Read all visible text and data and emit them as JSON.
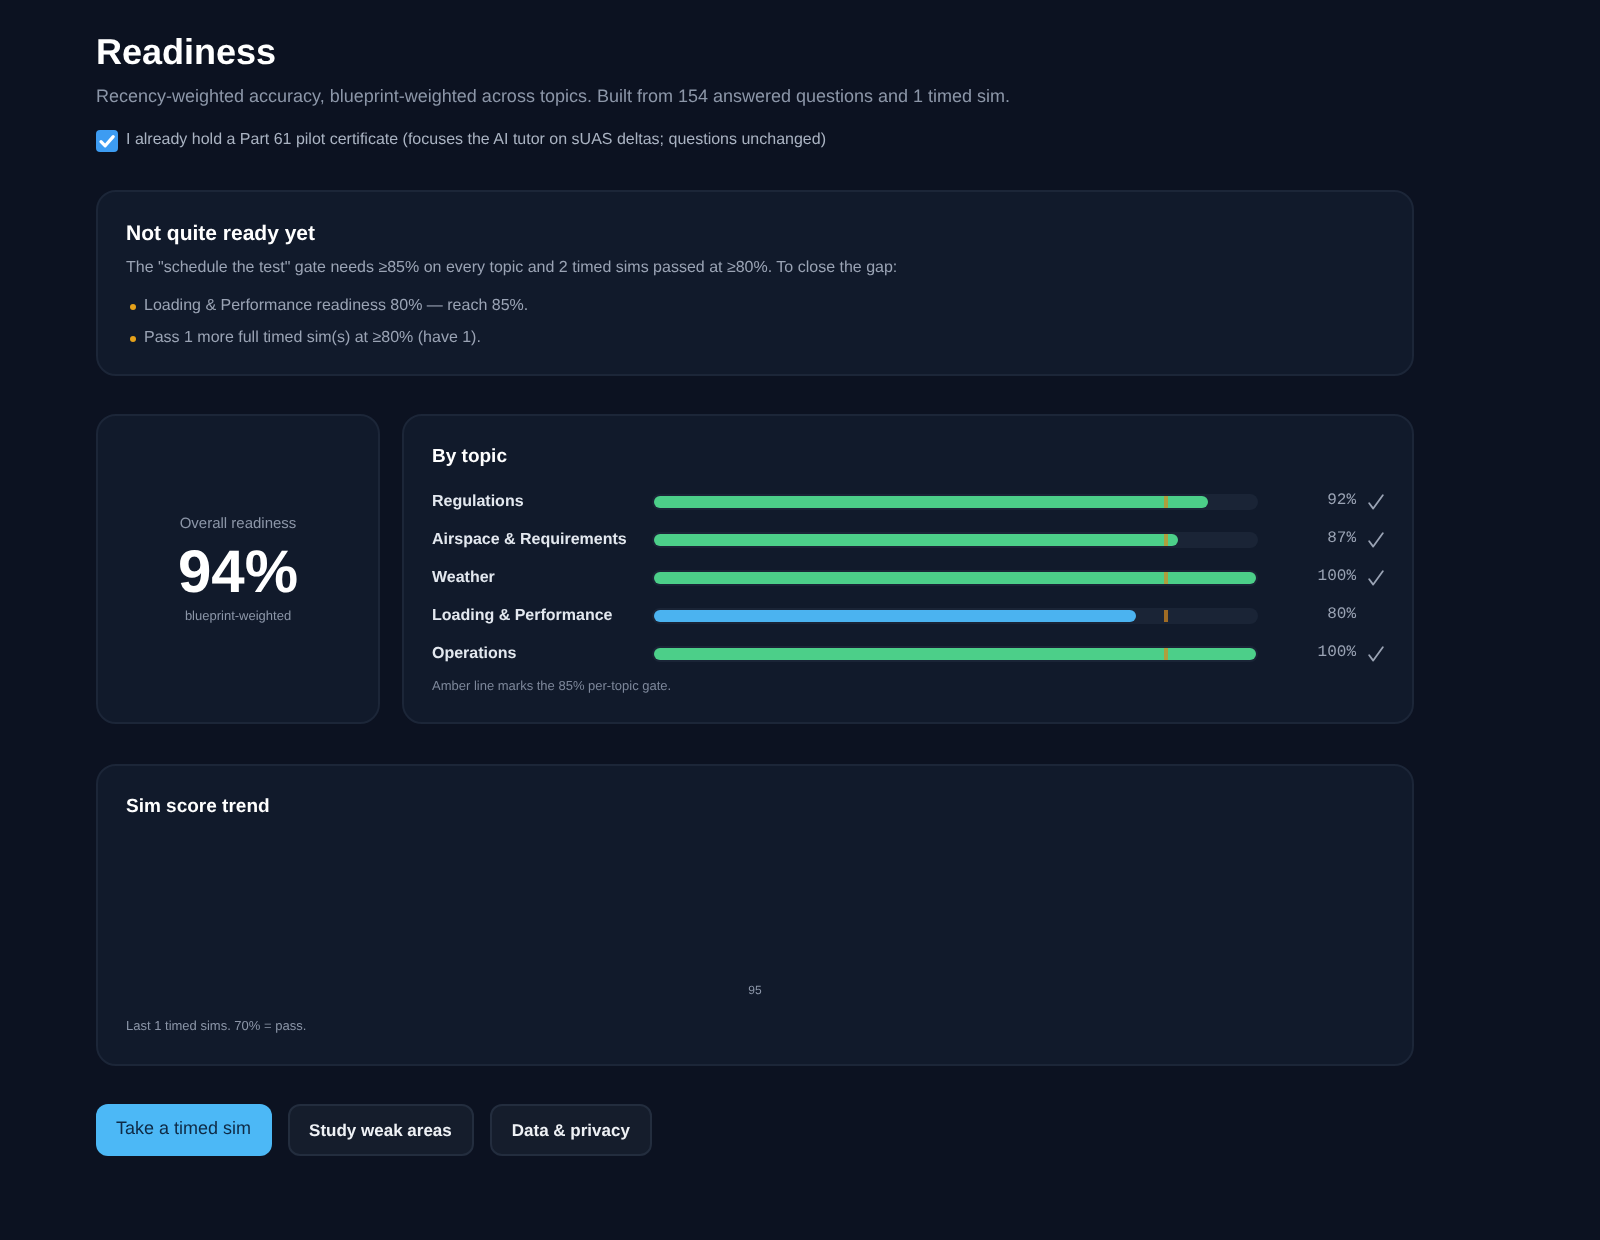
{
  "page": {
    "title": "Readiness",
    "subtitle": "Recency-weighted accuracy, blueprint-weighted across topics. Built from 154 answered questions and 1 timed sim."
  },
  "certificate_option": {
    "label": "I already hold a Part 61 pilot certificate (focuses the AI tutor on sUAS deltas; questions unchanged)",
    "checked": true
  },
  "status_card": {
    "title": "Not quite ready yet",
    "description": "The \"schedule the test\" gate needs ≥85% on every topic and 2 timed sims passed at ≥80%. To close the gap:",
    "steps": [
      "Loading & Performance readiness 80% — reach 85%.",
      "Pass 1 more full timed sim(s) at ≥80% (have 1)."
    ]
  },
  "overall": {
    "label": "Overall readiness",
    "value": "94%",
    "note": "blueprint-weighted"
  },
  "by_topic": {
    "title": "By topic",
    "gate": {
      "level": 0.85
    },
    "topics": [
      {
        "name": "Regulations",
        "level": 0.92,
        "reading": "92%",
        "met": true
      },
      {
        "name": "Airspace & Requirements",
        "level": 0.87,
        "reading": "87%",
        "met": true
      },
      {
        "name": "Weather",
        "level": 1,
        "reading": "100%",
        "met": true
      },
      {
        "name": "Loading & Performance",
        "level": 0.8,
        "reading": "80%",
        "met": false
      },
      {
        "name": "Operations",
        "level": 1,
        "reading": "100%",
        "met": true
      }
    ],
    "note": "Amber line marks the 85% per-topic gate."
  },
  "sim_trend": {
    "title": "Sim score trend",
    "score_labels": [
      "95"
    ],
    "caption": "Last 1 timed sims. 70% = pass."
  },
  "actions": [
    {
      "label": "Take a timed sim",
      "kind": "primary"
    },
    {
      "label": "Study weak areas",
      "kind": "secondary"
    },
    {
      "label": "Data & privacy",
      "kind": "secondary"
    }
  ]
}
